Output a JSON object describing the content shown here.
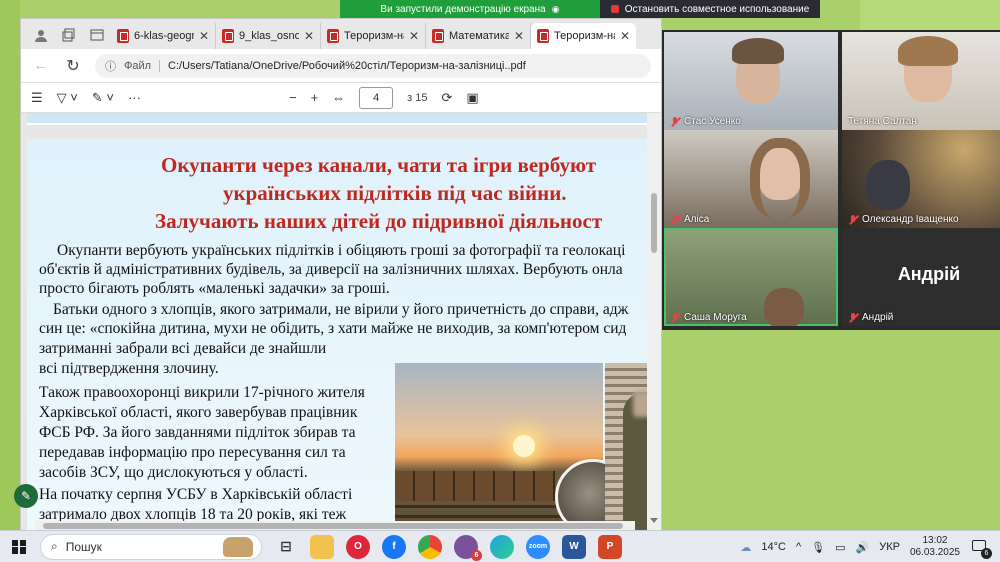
{
  "share": {
    "sharing_text": "Ви запустили демонстрацію екрана",
    "stop_text": "Остановить совместное использование"
  },
  "browser": {
    "tabs": [
      {
        "label": "6-klas-geograf"
      },
      {
        "label": "9_klas_osnovi"
      },
      {
        "label": "Тероризм-на"
      },
      {
        "label": "Математика_"
      },
      {
        "label": "Тероризм-на"
      }
    ],
    "address": {
      "scheme_label": "Файл",
      "url": "C:/Users/Tatiana/OneDrive/Робочий%20стіл/Тероризм-на-залізниці..pdf"
    },
    "pdf_toolbar": {
      "zoom_out": "−",
      "zoom_in": "+",
      "current_page": "4",
      "total_pages": "з 15"
    }
  },
  "document": {
    "title_lines": [
      "Окупанти через канали, чати та ігри вербуют",
      "українських підлітків під час війни.",
      "Залучають наших дітей до підривної діяльност"
    ],
    "paragraph_lines": [
      "Окупанти вербують українських підлітків і обіцяють гроші за фотографії та геолокаці",
      "об'єктів й адміністративних будівель, за диверсії на залізничних шляхах. Вербують онла",
      "просто бігають роблять «маленькі задачки» за гроші.",
      "Батьки одного з хлопців, якого затримали, не вірили у його причетність до справи, адж",
      "син це: «спокійна дитина, мухи не обідить, з хати майже не виходив, за комп'ютером сид",
      "затриманні забрали всі девайси де знайшли",
      "всі підтвердження злочину.",
      "Також правоохоронці викрили 17-річного жителя",
      "Харківської області, якого завербував працівник",
      "ФСБ РФ. За його завданнями підліток збирав та",
      "передавав інформацію про пересування сил та",
      "засобів ЗСУ, що дислокуються у області.",
      "На початку серпня УСБУ в Харківській області",
      "затримало двох хлопців 18 та 20 років, які теж"
    ]
  },
  "call": {
    "participants": [
      {
        "name": "Стас Усенко",
        "muted": true
      },
      {
        "name": "Тетяна Салтан",
        "muted": false
      },
      {
        "name": "Аліса",
        "muted": true
      },
      {
        "name": "Олександр Іващенко",
        "muted": true
      },
      {
        "name": "Саша Моруга",
        "muted": true
      },
      {
        "name": "Андрій",
        "muted": true,
        "avatar_text": "Андрій"
      }
    ]
  },
  "taskbar": {
    "search_placeholder": "Пошук",
    "weather": "14°C",
    "language": "УКР",
    "time": "13:02",
    "date": "06.03.2025",
    "notification_count": "6",
    "viber_badge": "6",
    "apps": [
      "task-view",
      "file-explorer",
      "opera",
      "facebook",
      "chrome",
      "viber",
      "edge",
      "zoom",
      "word",
      "powerpoint"
    ]
  }
}
